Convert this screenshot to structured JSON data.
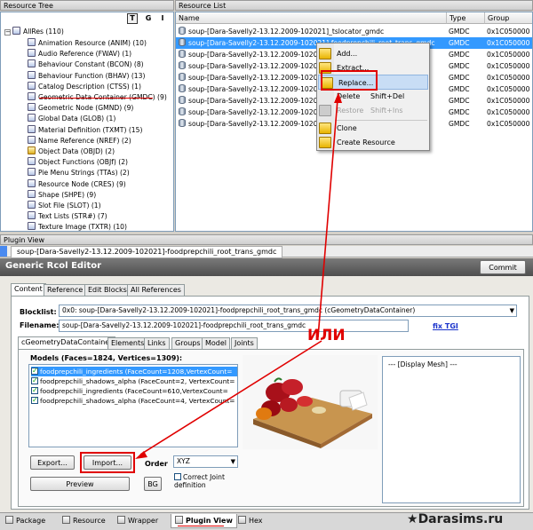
{
  "resource_tree": {
    "title": "Resource Tree",
    "tool_buttons": [
      "T",
      "G",
      "I"
    ],
    "root": "AllRes (110)",
    "items": [
      "Animation Resource (ANIM) (10)",
      "Audio Reference (FWAV) (1)",
      "Behaviour Constant (BCON) (8)",
      "Behaviour Function (BHAV) (13)",
      "Catalog Description (CTSS) (1)",
      "Geometric Data Container (GMDC) (9)",
      "Geometric Node (GMND) (9)",
      "Global Data (GLOB) (1)",
      "Material Definition (TXMT) (15)",
      "Name Reference (NREF) (2)",
      "Object Data (OBJD) (2)",
      "Object Functions (OBJf) (2)",
      "Pie Menu Strings (TTAs) (2)",
      "Resource Node (CRES) (9)",
      "Shape (SHPE) (9)",
      "Slot File (SLOT) (1)",
      "Text Lists (STR#) (7)",
      "Texture Image (TXTR) (10)"
    ]
  },
  "resource_list": {
    "title": "Resource List",
    "columns": [
      "Name",
      "Type",
      "Group"
    ],
    "rows": [
      {
        "name": "soup-[Dara-Savelly2-13.12.2009-102021]_tslocator_gmdc",
        "type": "GMDC",
        "group": "0x1C050000"
      },
      {
        "name": "soup-[Dara-Savelly2-13.12.2009-102021]-foodprepchili_root_trans_gmdc",
        "type": "GMDC",
        "group": "0x1C050000"
      },
      {
        "name": "soup-[Dara-Savelly2-13.12.2009-102021]",
        "type": "GMDC",
        "group": "0x1C050000"
      },
      {
        "name": "soup-[Dara-Savelly2-13.12.2009-102021]",
        "type": "GMDC",
        "group": "0x1C050000"
      },
      {
        "name": "soup-[Dara-Savelly2-13.12.2009-102021]",
        "type": "GMDC",
        "group": "0x1C050000"
      },
      {
        "name": "soup-[Dara-Savelly2-13.12.2009-102021]",
        "type": "GMDC",
        "group": "0x1C050000"
      },
      {
        "name": "soup-[Dara-Savelly2-13.12.2009-102021]",
        "type": "GMDC",
        "group": "0x1C050000"
      },
      {
        "name": "soup-[Dara-Savelly2-13.12.2009-102021]",
        "type": "GMDC",
        "group": "0x1C050000"
      },
      {
        "name": "soup-[Dara-Savelly2-13.12.2009-102021]",
        "type": "GMDC",
        "group": "0x1C050000"
      }
    ],
    "overflow_suffix": "mdc"
  },
  "context_menu": {
    "items": [
      {
        "label": "Add...",
        "key": ""
      },
      {
        "label": "Extract...",
        "key": ""
      },
      {
        "label": "Replace...",
        "key": ""
      },
      {
        "label": "Delete",
        "key": "Shift+Del"
      },
      {
        "label": "Restore",
        "key": "Shift+Ins"
      },
      {
        "label": "Clone",
        "key": ""
      },
      {
        "label": "Create Resource",
        "key": ""
      }
    ]
  },
  "plugin_view": {
    "title": "Plugin View",
    "resource_name": "soup-[Dara-Savelly2-13.12.2009-102021]-foodprepchili_root_trans_gmdc",
    "editor_title": "Generic Rcol Editor",
    "commit_label": "Commit",
    "tabs": [
      "Content",
      "Reference",
      "Edit Blocks",
      "All References"
    ],
    "blocklist_label": "Blocklist:",
    "blocklist_value": "0x0: soup-[Dara-Savelly2-13.12.2009-102021]-foodprepchili_root_trans_gmdc (cGeometryDataContainer)",
    "filename_label": "Filename:",
    "filename_value": "soup-[Dara-Savelly2-13.12.2009-102021]-foodprepchili_root_trans_gmdc",
    "fix_tgi": "fix TGI",
    "sub_tabs": [
      "cGeometryDataContainer",
      "Elements",
      "Links",
      "Groups",
      "Model",
      "Joints"
    ],
    "models_label": "Models (Faces=1824, Vertices=1309):",
    "models": [
      "foodprepchili_ingredients (FaceCount=1208,VertexCount=",
      "foodprepchili_shadows_alpha (FaceCount=2, VertexCount=",
      "foodprepchili_ingredients (FaceCount=610,VertexCount=",
      "foodprepchili_shadows_alpha (FaceCount=4, VertexCount="
    ],
    "display_mesh": "--- [Display Mesh] ---",
    "export_label": "Export...",
    "import_label": "Import...",
    "order_label": "Order",
    "order_value": "XYZ",
    "preview_label": "Preview",
    "bg_label": "BG",
    "correct_joint_label": "Correct Joint definition"
  },
  "annotation": "ИЛИ",
  "bottom_tabs": [
    "Package",
    "Resource",
    "Wrapper",
    "Plugin View",
    "Hex"
  ],
  "watermark": "Darasims.ru",
  "colors": {
    "accent_red": "#e00000",
    "selection": "#3399ff"
  }
}
